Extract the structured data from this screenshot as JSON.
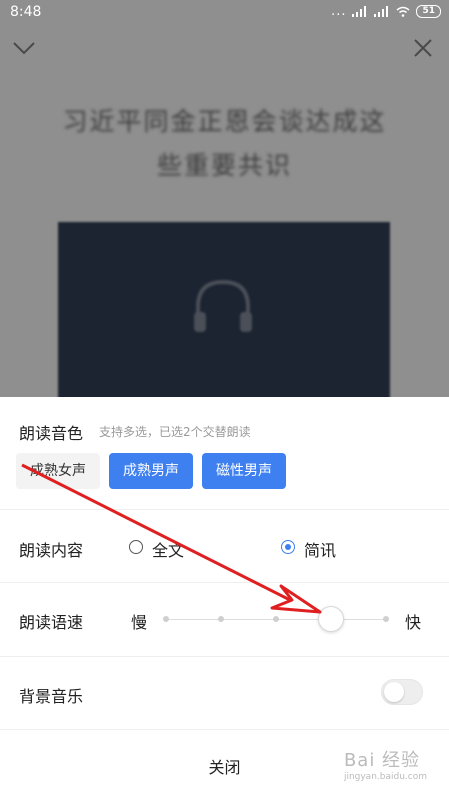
{
  "status_bar": {
    "time": "8:48",
    "dots": "...",
    "battery": "51"
  },
  "article": {
    "headline_lines": [
      "习近平同金正恩会谈达成这",
      "些重要共识"
    ]
  },
  "sheet": {
    "voice": {
      "title": "朗读音色",
      "hint": "支持多选，已选2个交替朗读",
      "options": [
        {
          "label": "成熟女声",
          "selected": false
        },
        {
          "label": "成熟男声",
          "selected": true
        },
        {
          "label": "磁性男声",
          "selected": true
        }
      ]
    },
    "content": {
      "title": "朗读内容",
      "options": [
        {
          "label": "全文",
          "selected": false
        },
        {
          "label": "简讯",
          "selected": true
        }
      ]
    },
    "speed": {
      "title": "朗读语速",
      "slow_label": "慢",
      "fast_label": "快",
      "steps": 5,
      "selected_step": 4
    },
    "music": {
      "title": "背景音乐",
      "enabled": false
    },
    "close_label": "关闭"
  },
  "watermark": {
    "text": "Bai 经验",
    "sub": "jingyan.baidu.com"
  },
  "colors": {
    "accent": "#3f80f0",
    "annotation_arrow": "#e02020"
  }
}
